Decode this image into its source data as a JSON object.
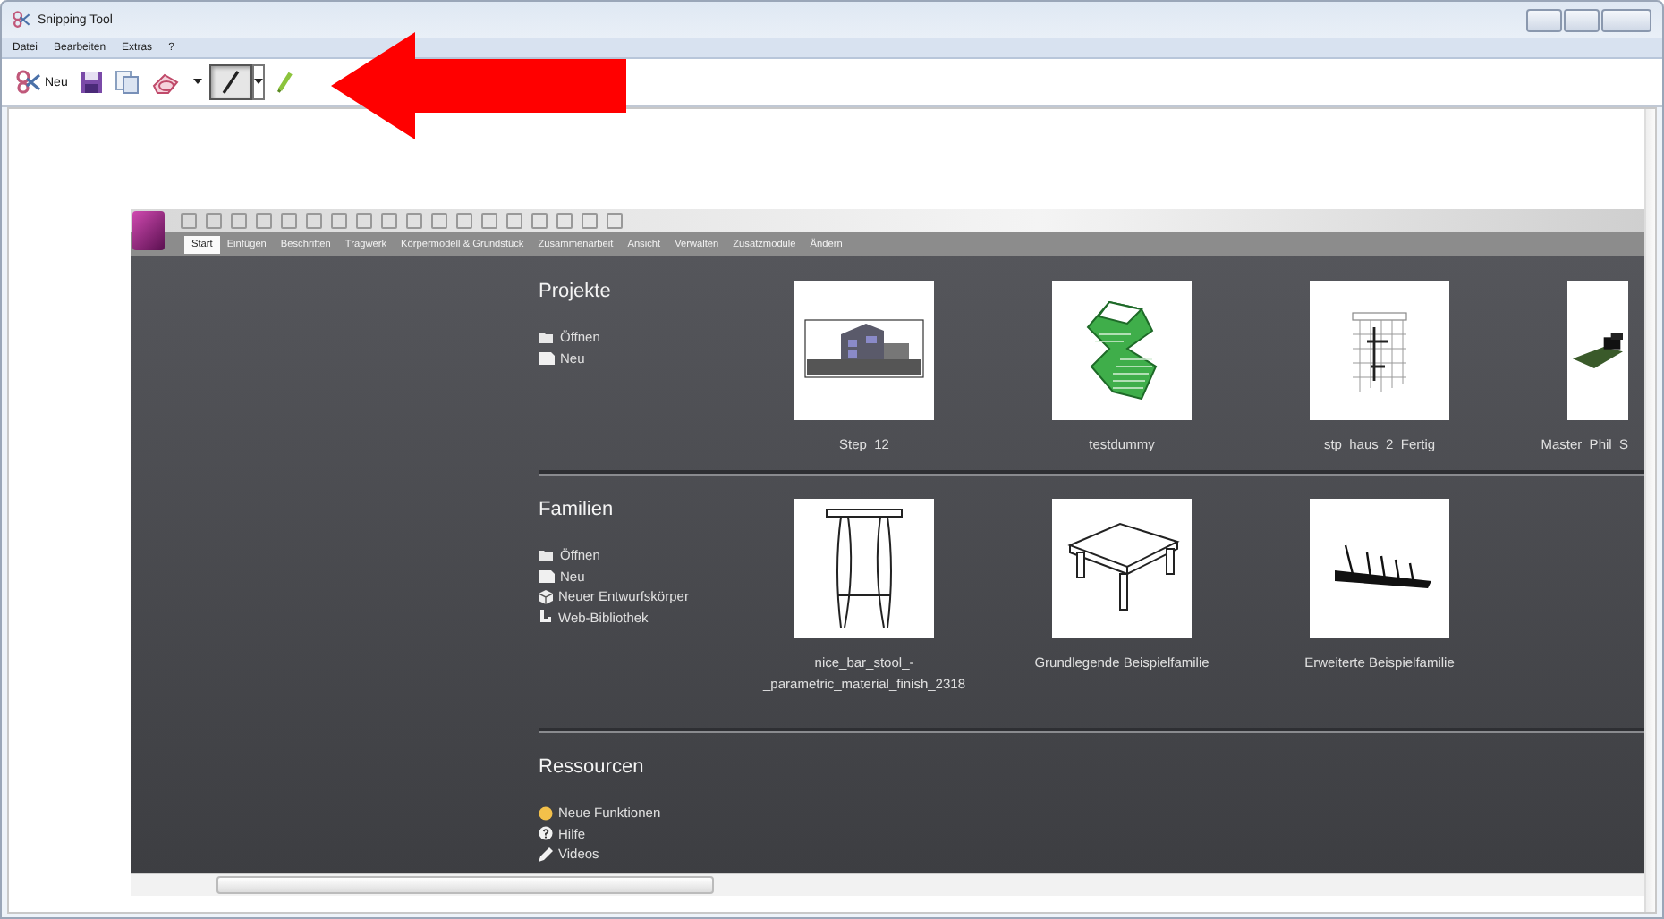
{
  "window": {
    "title": "Snipping Tool"
  },
  "menu": [
    {
      "label": "Datei"
    },
    {
      "label": "Bearbeiten"
    },
    {
      "label": "Extras"
    },
    {
      "label": "?"
    }
  ],
  "toolbar": {
    "new_label": "Neu",
    "tools": [
      {
        "kind": "pen",
        "selected": true
      },
      {
        "kind": "highlighter",
        "selected": false
      }
    ]
  },
  "snip": {
    "ribbon_tabs": [
      {
        "label": "Start",
        "selected": true
      },
      {
        "label": "Einfügen",
        "selected": false
      },
      {
        "label": "Beschriften",
        "selected": false
      },
      {
        "label": "Tragwerk",
        "selected": false
      },
      {
        "label": "Körpermodell & Grundstück",
        "selected": false
      },
      {
        "label": "Zusammenarbeit",
        "selected": false
      },
      {
        "label": "Ansicht",
        "selected": false
      },
      {
        "label": "Verwalten",
        "selected": false
      },
      {
        "label": "Zusatzmodule",
        "selected": false
      },
      {
        "label": "Ändern",
        "selected": false
      }
    ],
    "sections": [
      {
        "title": "Projekte",
        "links": [
          {
            "kind": "open",
            "label": "Öffnen"
          },
          {
            "kind": "new",
            "label": "Neu"
          }
        ],
        "items": [
          {
            "kind": "building",
            "caption": "Step_12"
          },
          {
            "kind": "twisted-tower",
            "caption": "testdummy"
          },
          {
            "kind": "plan",
            "caption": "stp_haus_2_Fertig"
          },
          {
            "kind": "site",
            "caption": "Master_Phil_S"
          }
        ]
      },
      {
        "title": "Familien",
        "links": [
          {
            "kind": "open",
            "label": "Öffnen"
          },
          {
            "kind": "new",
            "label": "Neu"
          },
          {
            "kind": "mass",
            "label": "Neuer Entwurfskörper"
          },
          {
            "kind": "web",
            "label": "Web-Bibliothek"
          }
        ],
        "items": [
          {
            "kind": "stool",
            "caption": "nice_bar_stool_-\n_parametric_material_finish_2318"
          },
          {
            "kind": "table",
            "caption": "Grundlegende Beispielfamilie"
          },
          {
            "kind": "rack",
            "caption": "Erweiterte Beispielfamilie"
          }
        ]
      },
      {
        "title": "Ressourcen",
        "links": [
          {
            "kind": "features",
            "label": "Neue Funktionen"
          },
          {
            "kind": "help",
            "label": "Hilfe"
          },
          {
            "kind": "video",
            "label": "Videos"
          }
        ]
      }
    ]
  }
}
